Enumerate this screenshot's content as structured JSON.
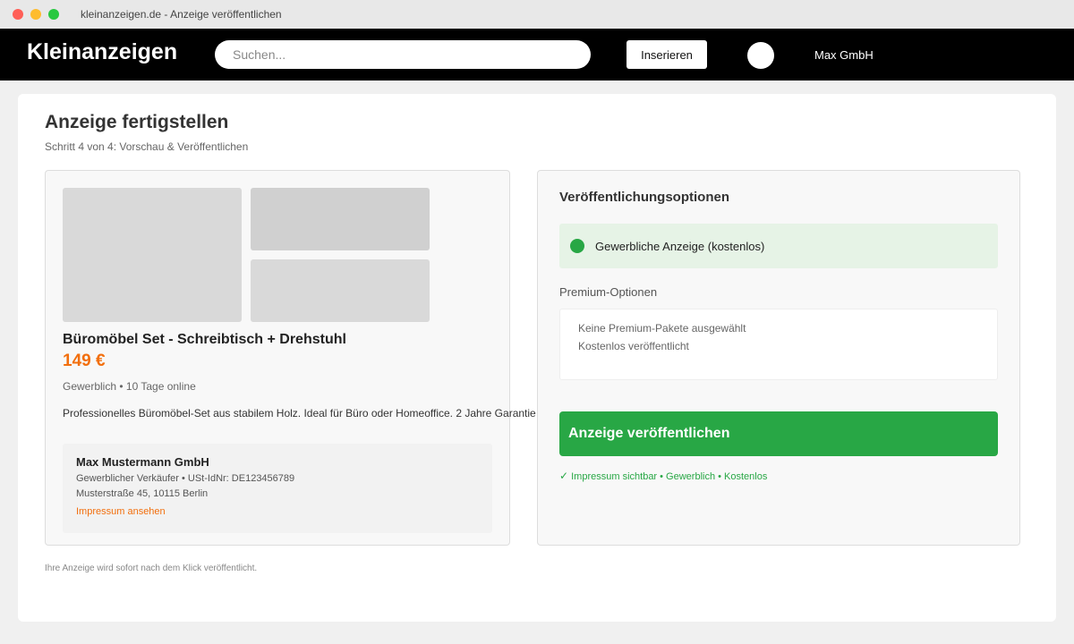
{
  "window": {
    "title": "kleinanzeigen.de - Anzeige veröffentlichen"
  },
  "nav": {
    "logo": "Kleinanzeigen",
    "search_placeholder": "Suchen...",
    "insert_label": "Inserieren",
    "user_name": "Max GmbH"
  },
  "page": {
    "title": "Anzeige fertigstellen",
    "step": "Schritt 4 von 4: Vorschau & Veröffentlichen",
    "footer_note": "Ihre Anzeige wird sofort nach dem Klick veröffentlicht."
  },
  "preview": {
    "ad_title": "Büromöbel Set - Schreibtisch + Drehstuhl",
    "price": "149 €",
    "meta": "Gewerblich • 10 Tage online",
    "description": "Professionelles Büromöbel-Set aus stabilem Holz. Ideal für Büro oder Homeoffice. 2 Jahre Garantie",
    "seller": {
      "name": "Max Mustermann GmbH",
      "line1": "Gewerblicher Verkäufer • USt-IdNr: DE123456789",
      "line2": "Musterstraße 45, 10115 Berlin",
      "impressum_link": "Impressum ansehen"
    }
  },
  "options": {
    "title": "Veröffentlichungsoptionen",
    "selected_option": "Gewerbliche Anzeige (kostenlos)",
    "premium_label": "Premium-Optionen",
    "premium_line1": "Keine Premium-Pakete ausgewählt",
    "premium_line2": "Kostenlos veröffentlicht",
    "publish_button": "Anzeige veröffentlichen",
    "publish_note_check": "✓",
    "publish_note": "Impressum sichtbar • Gewerblich • Kostenlos"
  },
  "colors": {
    "accent_orange": "#f26f0e",
    "success_green": "#28a745",
    "nav_black": "#000000"
  }
}
